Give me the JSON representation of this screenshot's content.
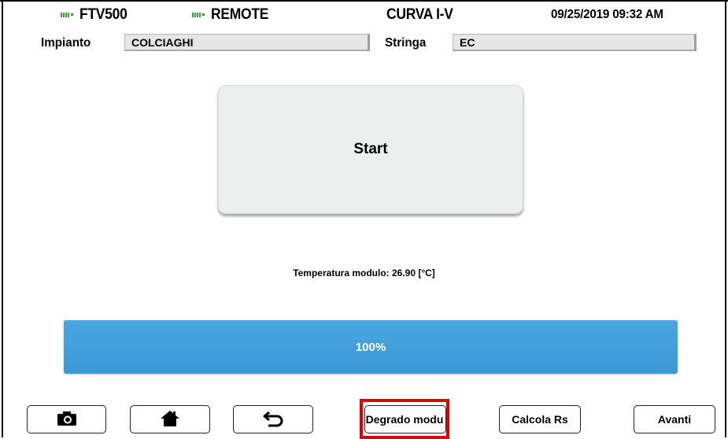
{
  "header": {
    "device_name": "FTV500",
    "remote_label": "REMOTE",
    "screen_title": "CURVA I-V",
    "datetime": "09/25/2019 09:32 AM",
    "battery_color": "#3a9a3a"
  },
  "fields": {
    "impianto_label": "Impianto",
    "impianto_value": "COLCIAGHI",
    "stringa_label": "Stringa",
    "stringa_value": "EC"
  },
  "main": {
    "start_label": "Start",
    "temperature_text": "Temperatura modulo: 26.90 [°C]"
  },
  "progress": {
    "label": "100%",
    "value": 1.0,
    "color": "#3b98d6"
  },
  "toolbar": {
    "camera_icon": "camera-icon",
    "home_icon": "home-icon",
    "back_icon": "back-arrow-icon",
    "degrado_label": "Degrado modu",
    "calcola_label": "Calcola Rs",
    "avanti_label": "Avanti",
    "highlight_color": "#e00000"
  }
}
